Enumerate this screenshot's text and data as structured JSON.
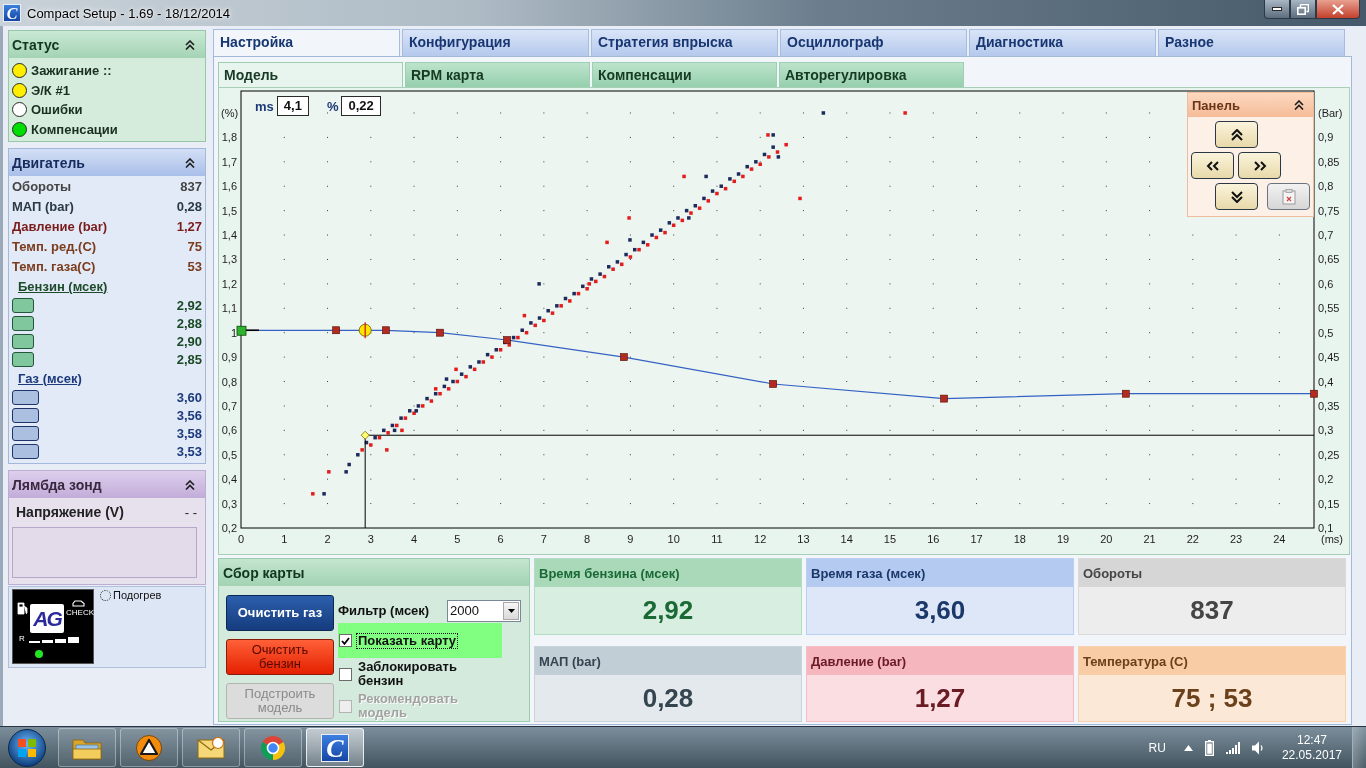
{
  "window": {
    "icon": "C",
    "title": "Compact Setup - 1.69 - 18/12/2014"
  },
  "sidebar": {
    "status": {
      "title": "Статус",
      "items": [
        {
          "label": "Зажигание ::",
          "color": "#ffee00"
        },
        {
          "label": "Э/К #1",
          "color": "#ffee00"
        },
        {
          "label": "Ошибки",
          "color": "#ffffff"
        },
        {
          "label": "Компенсации",
          "color": "#00dd00"
        }
      ]
    },
    "engine": {
      "title": "Двигатель",
      "rows": [
        {
          "label": "Обороты",
          "value": "837",
          "color": "#454545"
        },
        {
          "label": "МАП (bar)",
          "value": "0,28",
          "color": "#2b3b45"
        },
        {
          "label": "Давление (bar)",
          "value": "1,27",
          "color": "#7a1c1c"
        },
        {
          "label": "Темп. ред.(C)",
          "value": "75",
          "color": "#7a3c1c"
        },
        {
          "label": "Темп. газа(C)",
          "value": "53",
          "color": "#7a3c1c"
        }
      ],
      "groups": [
        {
          "kind": "petrol",
          "title": "Бензин (мсек)",
          "injectors": [
            "2,92",
            "2,88",
            "2,90",
            "2,85"
          ]
        },
        {
          "kind": "gas",
          "title": "Газ (мсек)",
          "injectors": [
            "3,60",
            "3,56",
            "3,58",
            "3,53"
          ]
        }
      ]
    },
    "lambda": {
      "title": "Лямбда зонд",
      "label": "Напряжение (V)",
      "value": "- -"
    },
    "switch": {
      "logo": "AG",
      "check_label": "CHECK",
      "range_label": "R",
      "heater": {
        "label": "Подогрев",
        "on": false
      }
    }
  },
  "tabs": [
    {
      "label": "Настройка",
      "selected": true
    },
    {
      "label": "Конфигурация",
      "selected": false
    },
    {
      "label": "Стратегия впрыска",
      "selected": false
    },
    {
      "label": "Осциллограф",
      "selected": false
    },
    {
      "label": "Диагностика",
      "selected": false
    },
    {
      "label": "Разное",
      "selected": false
    }
  ],
  "subtabs": [
    {
      "label": "Модель",
      "selected": true
    },
    {
      "label": "RPM карта",
      "selected": false
    },
    {
      "label": "Компенсации",
      "selected": false
    },
    {
      "label": "Авторегулировка",
      "selected": false
    }
  ],
  "chart": {
    "readouts": [
      {
        "label": "ms",
        "value": "4,1"
      },
      {
        "label": "%",
        "value": "0,22"
      }
    ],
    "panel": {
      "title": "Панель",
      "buttons": [
        {
          "kind": "up",
          "disabled": false
        },
        {
          "kind": "left",
          "disabled": false
        },
        {
          "kind": "right",
          "disabled": false
        },
        {
          "kind": "down",
          "disabled": false
        },
        {
          "kind": "clipboard",
          "disabled": true
        }
      ]
    },
    "chart_data": {
      "type": "scatter",
      "xlabel": "(ms)",
      "ylabel": "(%)",
      "y2label": "(Bar)",
      "xlim": [
        0,
        24.8
      ],
      "ylim": [
        0.2,
        1.99
      ],
      "y2lim": [
        0.1,
        0.995
      ],
      "grid": true,
      "xticks": [
        0,
        1,
        2,
        3,
        4,
        5,
        6,
        7,
        8,
        9,
        10,
        11,
        12,
        13,
        14,
        15,
        16,
        17,
        18,
        19,
        20,
        21,
        22,
        23,
        24
      ],
      "yticks": [
        {
          "value": 0.2,
          "label": "0,2"
        },
        {
          "value": 0.3,
          "label": "0,3"
        },
        {
          "value": 0.4,
          "label": "0,4"
        },
        {
          "value": 0.5,
          "label": "0,5"
        },
        {
          "value": 0.6,
          "label": "0,6"
        },
        {
          "value": 0.7,
          "label": "0,7"
        },
        {
          "value": 0.8,
          "label": "0,8"
        },
        {
          "value": 0.9,
          "label": "0,9"
        },
        {
          "value": 1,
          "label": "1"
        },
        {
          "value": 1.1,
          "label": "1,1"
        },
        {
          "value": 1.2,
          "label": "1,2"
        },
        {
          "value": 1.3,
          "label": "1,3"
        },
        {
          "value": 1.4,
          "label": "1,4"
        },
        {
          "value": 1.5,
          "label": "1,5"
        },
        {
          "value": 1.6,
          "label": "1,6"
        },
        {
          "value": 1.7,
          "label": "1,7"
        },
        {
          "value": 1.8,
          "label": "1,8"
        }
      ],
      "y2ticks": [
        {
          "value": 0.1,
          "label": "0,1"
        },
        {
          "value": 0.15,
          "label": "0,15"
        },
        {
          "value": 0.2,
          "label": "0,2"
        },
        {
          "value": 0.25,
          "label": "0,25"
        },
        {
          "value": 0.3,
          "label": "0,3"
        },
        {
          "value": 0.35,
          "label": "0,35"
        },
        {
          "value": 0.4,
          "label": "0,4"
        },
        {
          "value": 0.45,
          "label": "0,45"
        },
        {
          "value": 0.5,
          "label": "0,5"
        },
        {
          "value": 0.55,
          "label": "0,55"
        },
        {
          "value": 0.6,
          "label": "0,6"
        },
        {
          "value": 0.65,
          "label": "0,65"
        },
        {
          "value": 0.7,
          "label": "0,7"
        },
        {
          "value": 0.75,
          "label": "0,75"
        },
        {
          "value": 0.8,
          "label": "0,8"
        },
        {
          "value": 0.85,
          "label": "0,85"
        },
        {
          "value": 0.9,
          "label": "0,9"
        }
      ],
      "series": [
        {
          "type": "scatter",
          "color": "#e41c1c",
          "x": [
            2.8,
            3,
            3.2,
            3.4,
            3.6,
            3.8,
            4,
            4.2,
            4.4,
            4.6,
            4.8,
            5,
            5.2,
            5.4,
            5.6,
            5.8,
            6,
            6.2,
            6.4,
            6.6,
            6.8,
            7,
            7.2,
            7.4,
            7.6,
            7.8,
            8,
            8.2,
            8.4,
            8.6,
            8.8,
            9,
            9.2,
            9.4,
            9.6,
            9.8,
            10,
            10.2,
            10.4,
            10.6,
            10.8,
            11,
            11.2,
            11.4,
            11.6,
            11.8,
            12,
            12.2,
            12.4,
            12.6,
            1.66,
            2.03,
            3.37,
            3.72,
            4.5,
            4.97,
            6.55,
            8.05,
            8.46,
            8.97,
            10.24,
            12.18,
            12.92,
            15.35
          ],
          "values": [
            0.52,
            0.54,
            0.57,
            0.59,
            0.62,
            0.65,
            0.67,
            0.7,
            0.72,
            0.75,
            0.77,
            0.8,
            0.82,
            0.85,
            0.88,
            0.9,
            0.93,
            0.95,
            0.98,
            1,
            1.03,
            1.05,
            1.08,
            1.11,
            1.13,
            1.16,
            1.18,
            1.21,
            1.23,
            1.26,
            1.28,
            1.31,
            1.34,
            1.36,
            1.39,
            1.41,
            1.44,
            1.46,
            1.49,
            1.51,
            1.54,
            1.57,
            1.59,
            1.62,
            1.64,
            1.67,
            1.69,
            1.72,
            1.74,
            1.77,
            0.34,
            0.43,
            0.52,
            0.6,
            0.77,
            0.85,
            1.07,
            1.2,
            1.37,
            1.47,
            1.64,
            1.81,
            1.55,
            1.9
          ]
        },
        {
          "type": "scatter",
          "color": "#1c2a5c",
          "x": [
            2.5,
            2.7,
            2.9,
            3.1,
            3.3,
            3.5,
            3.7,
            3.9,
            4.1,
            4.3,
            4.5,
            4.7,
            4.9,
            5.1,
            5.3,
            5.5,
            5.7,
            5.9,
            6.1,
            6.3,
            6.5,
            6.7,
            6.9,
            7.1,
            7.3,
            7.5,
            7.7,
            7.9,
            8.1,
            8.3,
            8.5,
            8.7,
            8.9,
            9.1,
            9.3,
            9.5,
            9.7,
            9.9,
            10.1,
            10.3,
            10.5,
            10.7,
            10.9,
            11.1,
            11.3,
            11.5,
            11.7,
            11.9,
            12.1,
            12.3,
            1.92,
            2.43,
            3.55,
            4.05,
            4.75,
            6.89,
            8.99,
            10.35,
            10.75,
            12.3,
            12.42,
            13.46
          ],
          "values": [
            0.46,
            0.5,
            0.55,
            0.57,
            0.6,
            0.62,
            0.65,
            0.68,
            0.7,
            0.73,
            0.75,
            0.78,
            0.8,
            0.83,
            0.86,
            0.88,
            0.91,
            0.93,
            0.96,
            0.98,
            1.01,
            1.04,
            1.06,
            1.09,
            1.11,
            1.14,
            1.16,
            1.19,
            1.22,
            1.24,
            1.27,
            1.29,
            1.32,
            1.34,
            1.37,
            1.4,
            1.42,
            1.45,
            1.47,
            1.5,
            1.52,
            1.55,
            1.58,
            1.6,
            1.63,
            1.65,
            1.68,
            1.7,
            1.73,
            1.76,
            0.34,
            0.43,
            0.6,
            0.68,
            0.81,
            1.2,
            1.38,
            1.47,
            1.64,
            1.81,
            1.72,
            1.9
          ]
        },
        {
          "type": "line",
          "color": "#3462c4",
          "marker": "square",
          "x": [
            0,
            2.2,
            3.35,
            4.6,
            6.15,
            8.85,
            12.3,
            16.25,
            20.45,
            24.8
          ],
          "values": [
            1.01,
            1.01,
            1.01,
            1.0,
            0.97,
            0.9,
            0.79,
            0.73,
            0.75,
            0.75
          ]
        }
      ],
      "ref_lines": [
        {
          "axis": "x",
          "value": 2.87
        },
        {
          "axis": "y",
          "value": 0.58
        }
      ]
    }
  },
  "map_capture": {
    "title": "Сбор карты",
    "buttons": [
      {
        "label": "Очистить газ",
        "kind": "primary",
        "disabled": false
      },
      {
        "label": "Очистить бензин",
        "kind": "danger",
        "disabled": false
      },
      {
        "label": "Подстроить модель",
        "kind": "neutral",
        "disabled": true
      }
    ],
    "filter": {
      "label": "Фильтр (мсек)",
      "value": "2000"
    },
    "checkboxes": [
      {
        "label": "Показать карту",
        "checked": true,
        "disabled": false,
        "highlighted": true,
        "focused": true
      },
      {
        "label": "Заблокировать бензин",
        "checked": false,
        "disabled": false,
        "highlighted": false,
        "focused": false
      },
      {
        "label": "Рекомендовать модель",
        "checked": false,
        "disabled": true,
        "highlighted": false,
        "focused": false
      }
    ]
  },
  "displays": [
    {
      "title": "Время бензина (мсек)",
      "value": "2,92",
      "color": "#a9d9b9"
    },
    {
      "title": "Время газа (мсек)",
      "value": "3,60",
      "color": "#b4caf0"
    },
    {
      "title": "Обороты",
      "value": "837",
      "color": "#d6d6d6"
    },
    {
      "title": "МАП (bar)",
      "value": "0,28",
      "color": "#c2ced6"
    },
    {
      "title": "Давление (bar)",
      "value": "1,27",
      "color": "#f6b6be"
    },
    {
      "title": "Температура (C)",
      "value": "75 ; 53",
      "color": "#f8cca4"
    }
  ],
  "taskbar": {
    "apps": [
      {
        "kind": "folder",
        "selected": false
      },
      {
        "kind": "triangle",
        "selected": false
      },
      {
        "kind": "envelope",
        "selected": false
      },
      {
        "kind": "ring",
        "selected": false
      },
      {
        "kind": "app",
        "glyph": "C",
        "selected": true
      }
    ],
    "tray": {
      "language": "RU",
      "time": "12:47",
      "date": "22.05.2017"
    }
  }
}
